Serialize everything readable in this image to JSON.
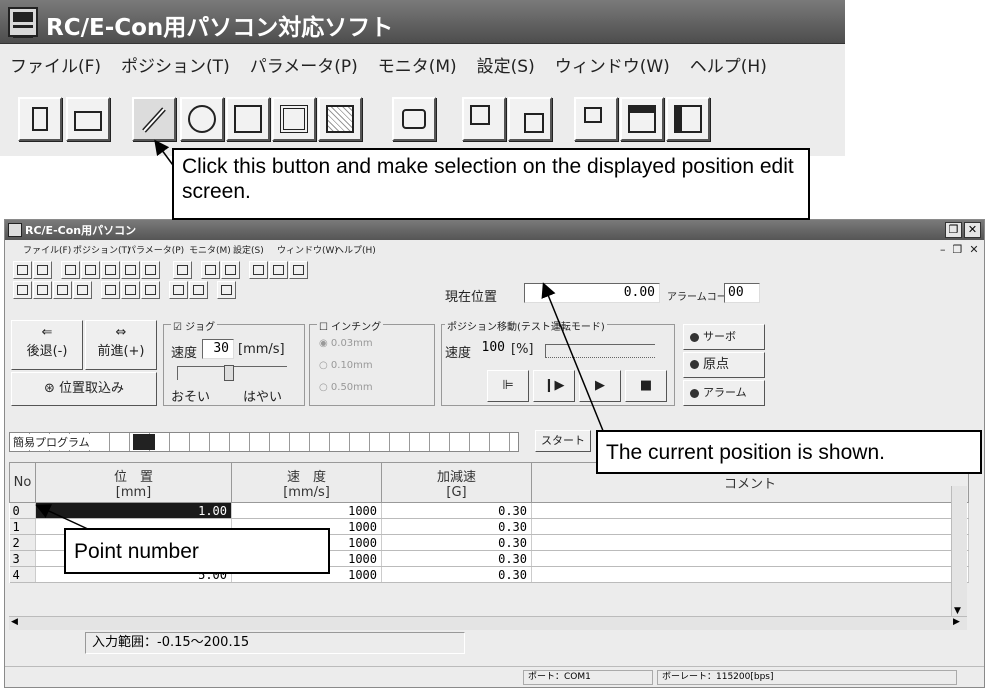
{
  "app_title": "RC/E-Con用パソコン対応ソフト",
  "menu": [
    "ファイル(F)",
    "ポジション(T)",
    "パラメータ(P)",
    "モニタ(M)",
    "設定(S)",
    "ウィンドウ(W)",
    "ヘルプ(H)"
  ],
  "callouts": {
    "button_hint": "Click this button and make selection on the displayed position edit screen.",
    "current_position": "The current position is shown.",
    "point_number": "Point number"
  },
  "window": {
    "title": "RC/E-Con用パソコン",
    "current_position_label": "現在位置",
    "current_position_value": "0.00",
    "alarm_code_label": "アラームコード",
    "alarm_code_value": "00",
    "jog": {
      "checkbox_label": "ジョグ",
      "back_button": "後退(-)",
      "forward_button": "前進(+)",
      "speed_label": "速度",
      "speed_value": "30",
      "speed_unit": "[mm/s]",
      "slow_label": "おそい",
      "fast_label": "はやい",
      "capture_button": "位置取込み"
    },
    "inching": {
      "label": "インチング",
      "options": [
        "0.03mm",
        "0.10mm",
        "0.50mm"
      ]
    },
    "position_move": {
      "label": "ポジション移動(テスト運転モード)",
      "speed_label": "速度",
      "speed_value": "100",
      "speed_unit": "[%]"
    },
    "status": {
      "servo": "サーボ",
      "home": "原点",
      "alarm": "アラーム"
    },
    "simple_program_label": "簡易プログラム",
    "start_button": "スタート",
    "table": {
      "headers": {
        "no": "No",
        "position": "位　置",
        "position_unit": "[mm]",
        "speed": "速　度",
        "speed_unit": "[mm/s]",
        "accel": "加減速",
        "accel_unit": "[G]",
        "comment": "コメント"
      },
      "rows": [
        {
          "no": "0",
          "position": "1.00",
          "speed": "1000",
          "accel": "0.30"
        },
        {
          "no": "1",
          "position": "",
          "speed": "1000",
          "accel": "0.30"
        },
        {
          "no": "2",
          "position": "",
          "speed": "1000",
          "accel": "0.30"
        },
        {
          "no": "3",
          "position": "",
          "speed": "1000",
          "accel": "0.30"
        },
        {
          "no": "4",
          "position": "5.00",
          "speed": "1000",
          "accel": "0.30"
        }
      ]
    },
    "input_range": "入力範囲：-0.15～200.15",
    "port": "ポート：COM1",
    "baud": "ボーレート：115200[bps]"
  }
}
